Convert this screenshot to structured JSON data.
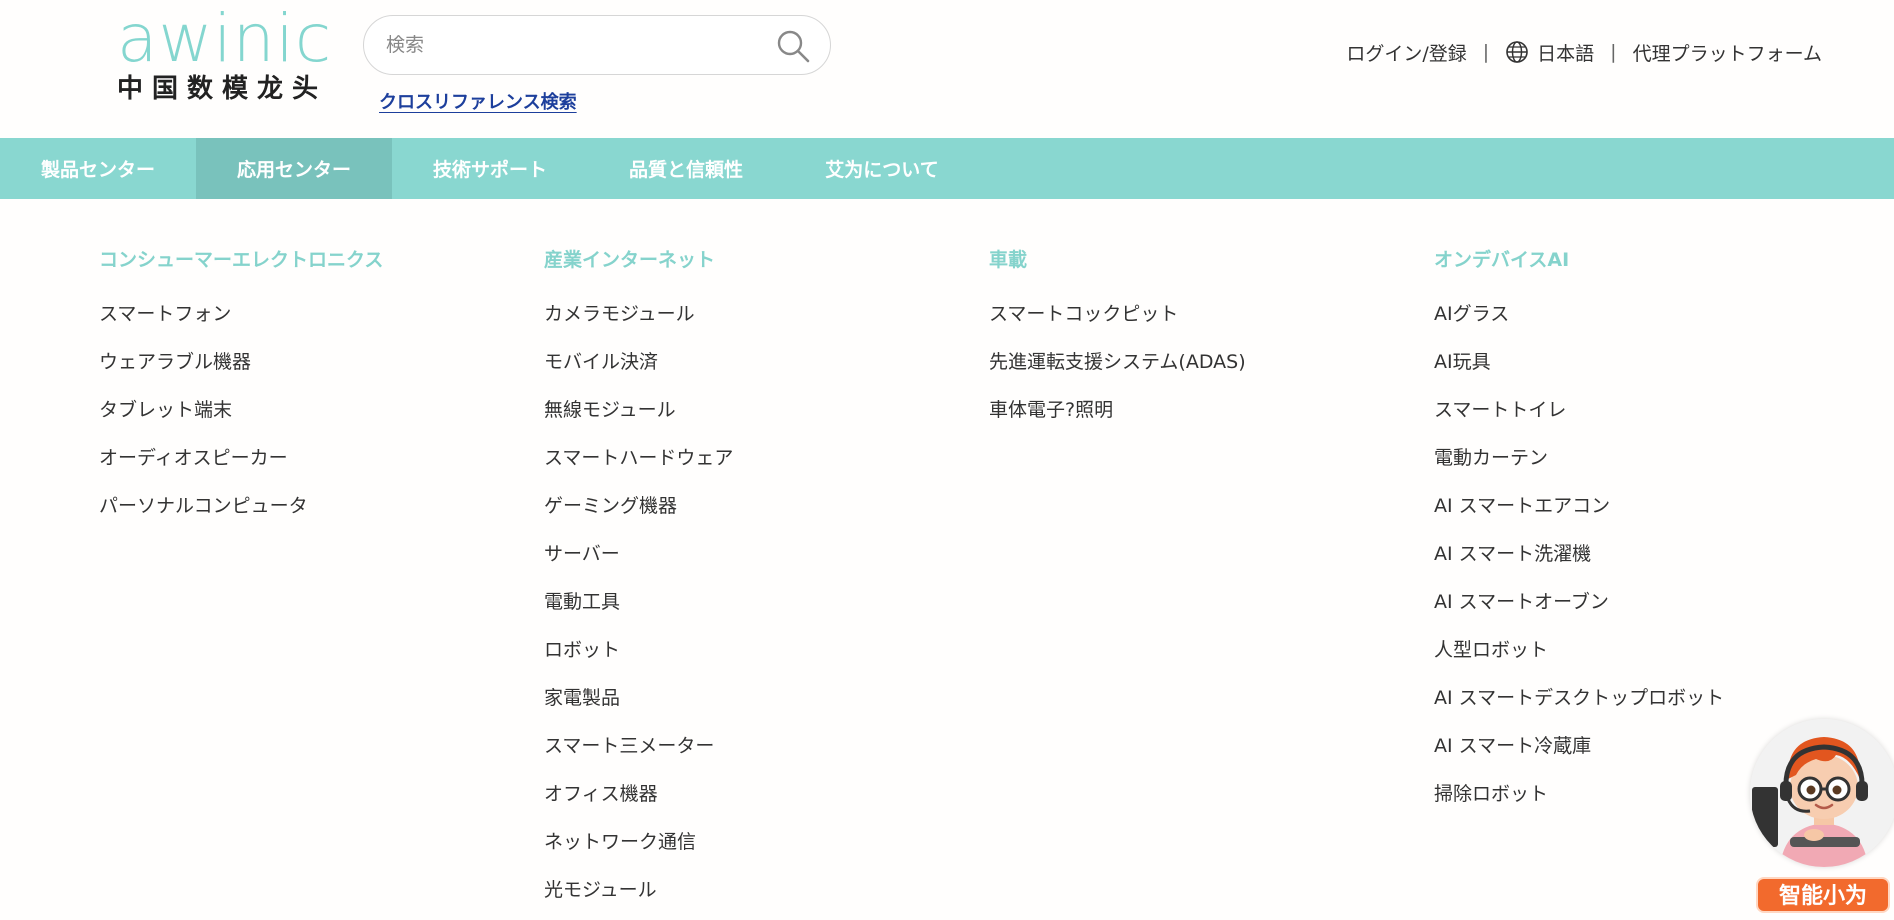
{
  "header": {
    "logo_word": "awinic",
    "logo_sub": "中国数模龙头",
    "search_placeholder": "検索",
    "cross_reference": "クロスリファレンス検索",
    "login": "ログイン/登録",
    "separator": "|",
    "language": "日本語",
    "agent_platform": "代理プラットフォーム"
  },
  "nav": {
    "items": [
      {
        "label": "製品センター"
      },
      {
        "label": "応用センター"
      },
      {
        "label": "技術サポート"
      },
      {
        "label": "品質と信頼性"
      },
      {
        "label": "艾为について"
      }
    ]
  },
  "mega_menu": {
    "columns": [
      {
        "title": "コンシューマーエレクトロニクス",
        "items": [
          "スマートフォン",
          "ウェアラブル機器",
          "タブレット端末",
          "オーディオスピーカー",
          "パーソナルコンピュータ"
        ]
      },
      {
        "title": "産業インターネット",
        "items": [
          "カメラモジュール",
          "モバイル決済",
          "無線モジュール",
          "スマートハードウェア",
          "ゲーミング機器",
          "サーバー",
          "電動工具",
          "ロボット",
          "家電製品",
          "スマート三メーター",
          "オフィス機器",
          "ネットワーク通信",
          "光モジュール"
        ]
      },
      {
        "title": "車載",
        "items": [
          "スマートコックピット",
          "先進運転支援システム(ADAS)",
          "車体電子?照明"
        ]
      },
      {
        "title": "オンデバイスAI",
        "items": [
          "AIグラス",
          "AI玩具",
          "スマートトイレ",
          "電動カーテン",
          "AI スマートエアコン",
          "AI スマート洗濯機",
          "AI スマートオーブン",
          "人型ロボット",
          "AI スマートデスクトップロボット",
          "AI スマート冷蔵庫",
          "掃除ロボット"
        ]
      }
    ]
  },
  "chat_widget": {
    "label": "智能小为"
  },
  "colors": {
    "brand_teal": "#89d7d0",
    "nav_active": "#79c2bc",
    "link_blue": "#1d3f9c",
    "chat_orange": "#f26a2d"
  }
}
